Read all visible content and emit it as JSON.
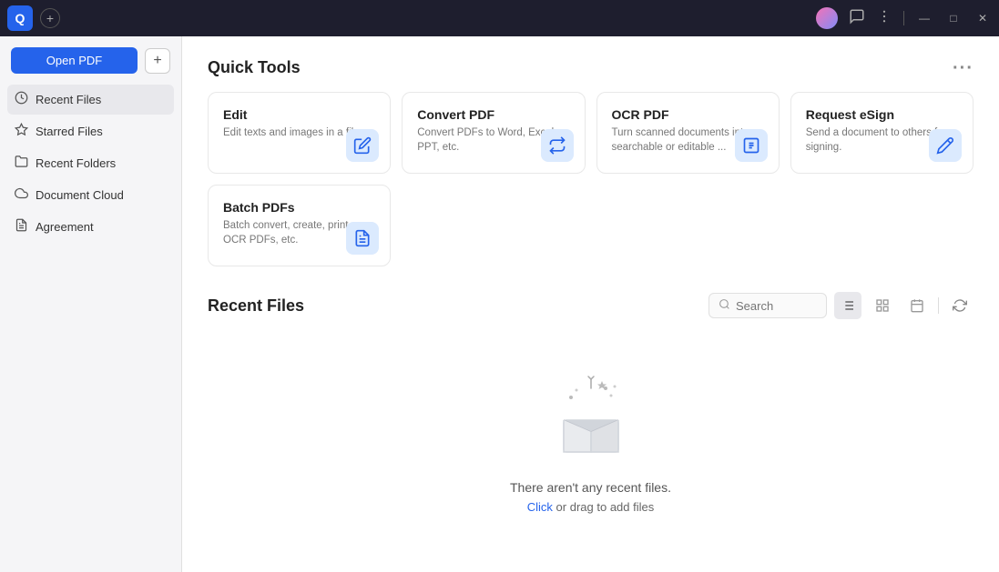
{
  "titlebar": {
    "logo_label": "Q",
    "add_tab_label": "+",
    "controls": {
      "chat_icon": "💬",
      "more_icon": "⋯",
      "minimize": "—",
      "maximize": "□",
      "close": "✕"
    }
  },
  "sidebar": {
    "open_pdf_label": "Open PDF",
    "add_icon": "+",
    "nav_items": [
      {
        "id": "recent-files",
        "label": "Recent Files",
        "icon": "🕐",
        "active": true
      },
      {
        "id": "starred-files",
        "label": "Starred Files",
        "icon": "☆",
        "active": false
      },
      {
        "id": "recent-folders",
        "label": "Recent Folders",
        "icon": "📁",
        "active": false
      },
      {
        "id": "document-cloud",
        "label": "Document Cloud",
        "icon": "☁",
        "active": false
      },
      {
        "id": "agreement",
        "label": "Agreement",
        "icon": "📋",
        "active": false
      }
    ]
  },
  "main": {
    "quick_tools_title": "Quick Tools",
    "more_options_icon": "•••",
    "tools": [
      {
        "id": "edit",
        "title": "Edit",
        "description": "Edit texts and images in a file.",
        "icon_type": "edit"
      },
      {
        "id": "convert-pdf",
        "title": "Convert PDF",
        "description": "Convert PDFs to Word, Excel, PPT, etc.",
        "icon_type": "convert"
      },
      {
        "id": "ocr-pdf",
        "title": "OCR PDF",
        "description": "Turn scanned documents into searchable or editable ...",
        "icon_type": "ocr"
      },
      {
        "id": "request-esign",
        "title": "Request eSign",
        "description": "Send a document to others for signing.",
        "icon_type": "esign"
      },
      {
        "id": "batch-pdfs",
        "title": "Batch PDFs",
        "description": "Batch convert, create, print, OCR PDFs, etc.",
        "icon_type": "batch"
      }
    ],
    "recent_files_title": "Recent Files",
    "search_placeholder": "Search",
    "empty_state": {
      "message": "There aren't any recent files.",
      "action_click": "Click",
      "action_middle": " or drag ",
      "action_end": "to add files"
    }
  }
}
